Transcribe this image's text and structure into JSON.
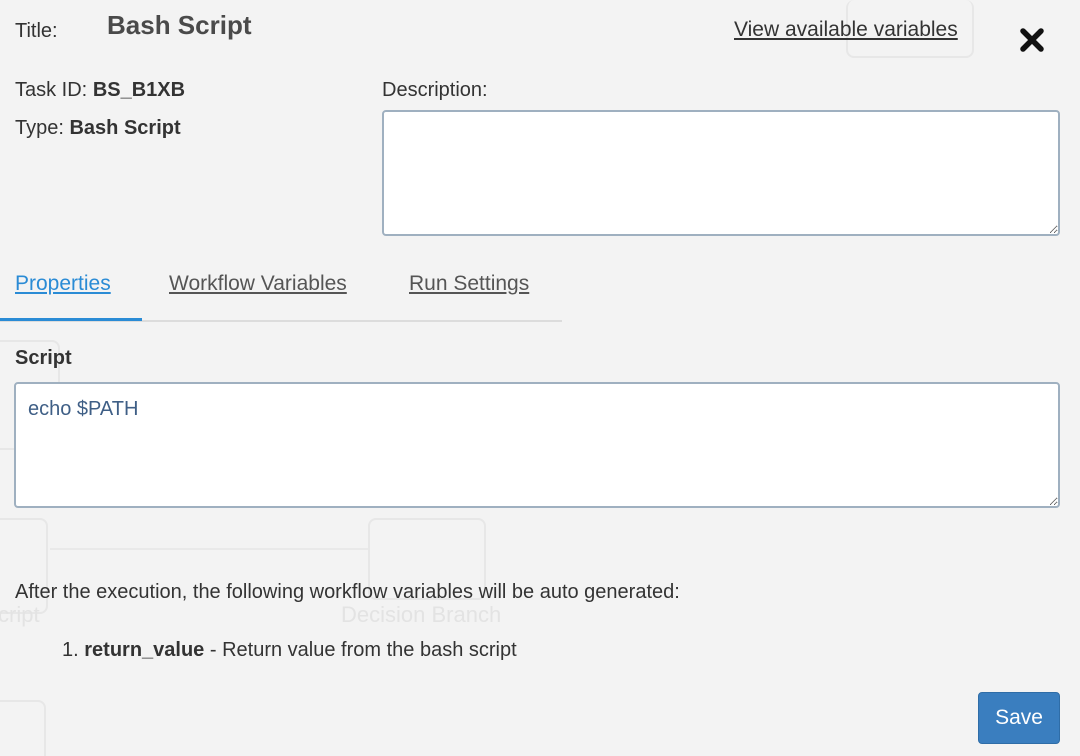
{
  "header": {
    "title_label": "Title:",
    "title_value": "Bash Script",
    "view_variables_link": "View available variables",
    "close_icon": "close-icon"
  },
  "meta": {
    "task_id_label": "Task ID:",
    "task_id_value": "BS_B1XB",
    "type_label": "Type:",
    "type_value": "Bash Script"
  },
  "description": {
    "label": "Description:",
    "value": ""
  },
  "tabs": [
    {
      "label": "Properties",
      "active": true
    },
    {
      "label": "Workflow Variables",
      "active": false
    },
    {
      "label": "Run Settings",
      "active": false
    }
  ],
  "script": {
    "label": "Script",
    "value": "echo $PATH"
  },
  "generated": {
    "intro": "After the execution, the following workflow variables will be auto generated:",
    "items": [
      {
        "number": "1.",
        "name": "return_value",
        "description": " - Return value from the bash script"
      }
    ]
  },
  "background": {
    "ghost_labels": [
      "cript",
      "Decision Branch"
    ]
  },
  "footer": {
    "save_label": "Save"
  },
  "colors": {
    "accent": "#2a8bd5",
    "save_button": "#3a7ebf"
  }
}
